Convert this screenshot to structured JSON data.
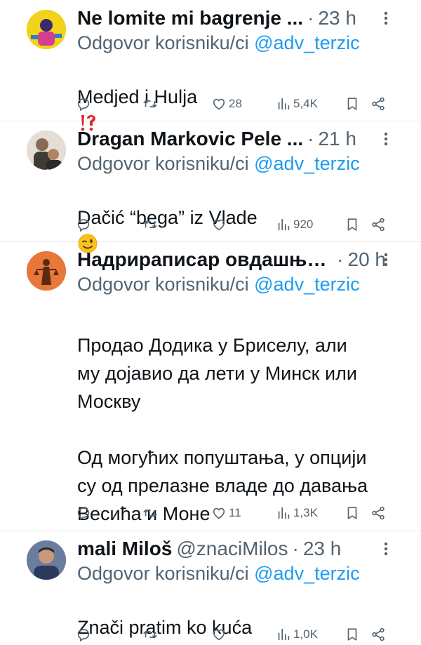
{
  "tweets": [
    {
      "name": "Ne lomite mi bagrenje ...",
      "handle": "",
      "time": "23 h",
      "reply_label": "Odgovor korisniku/ci",
      "reply_mention": "@adv_terzic",
      "text": "Medjed i Hulja",
      "text_emoji": "interrobang-emoji",
      "likes": "28",
      "views": "5,4K",
      "avatar_icon": "avatar-yellow-cartoon",
      "avatar_color": "#f2d21a"
    },
    {
      "name": "Dragan Markovic Pele ...",
      "handle": "",
      "time": "21 h",
      "reply_label": "Odgovor korisniku/ci",
      "reply_mention": "@adv_terzic",
      "text": "Dačić “bega” iz Vlade",
      "text_emoji": "winking-face-emoji",
      "likes": "",
      "views": "920",
      "avatar_icon": "avatar-photo-people",
      "avatar_color": "#c9c2b8"
    },
    {
      "name": "Надрираписар овдашњи™",
      "handle": "",
      "time": "20 h",
      "reply_label": "Odgovor korisniku/ci",
      "reply_mention": "@adv_terzic",
      "text": "Продао Додика у Бриселу, али\nму дојавио да лети у Минск или\nМоскву\n\nОд могућих попуштања, у опцији\nсу од прелазне владе до давања\nВесића и Моне",
      "text_emoji": "",
      "likes": "11",
      "views": "1,3K",
      "avatar_icon": "avatar-orange-statue",
      "avatar_color": "#e8773a"
    },
    {
      "name": "mali Miloš",
      "handle": "@znaciMilos",
      "time": "23 h",
      "reply_label": "Odgovor korisniku/ci",
      "reply_mention": "@adv_terzic",
      "text": "Znači pratim ko kuća",
      "text_emoji": "",
      "likes": "",
      "views": "1,0K",
      "avatar_icon": "avatar-photo-man",
      "avatar_color": "#7a8aa8"
    }
  ],
  "icons": {
    "reply": "reply-icon",
    "retweet": "retweet-icon",
    "like": "heart-icon",
    "views": "views-chart-icon",
    "bookmark": "bookmark-icon",
    "share": "share-icon",
    "more": "more-icon"
  },
  "colors": {
    "link": "#1d9bf0",
    "secondary_text": "#536471",
    "divider": "#e6e9ec"
  }
}
